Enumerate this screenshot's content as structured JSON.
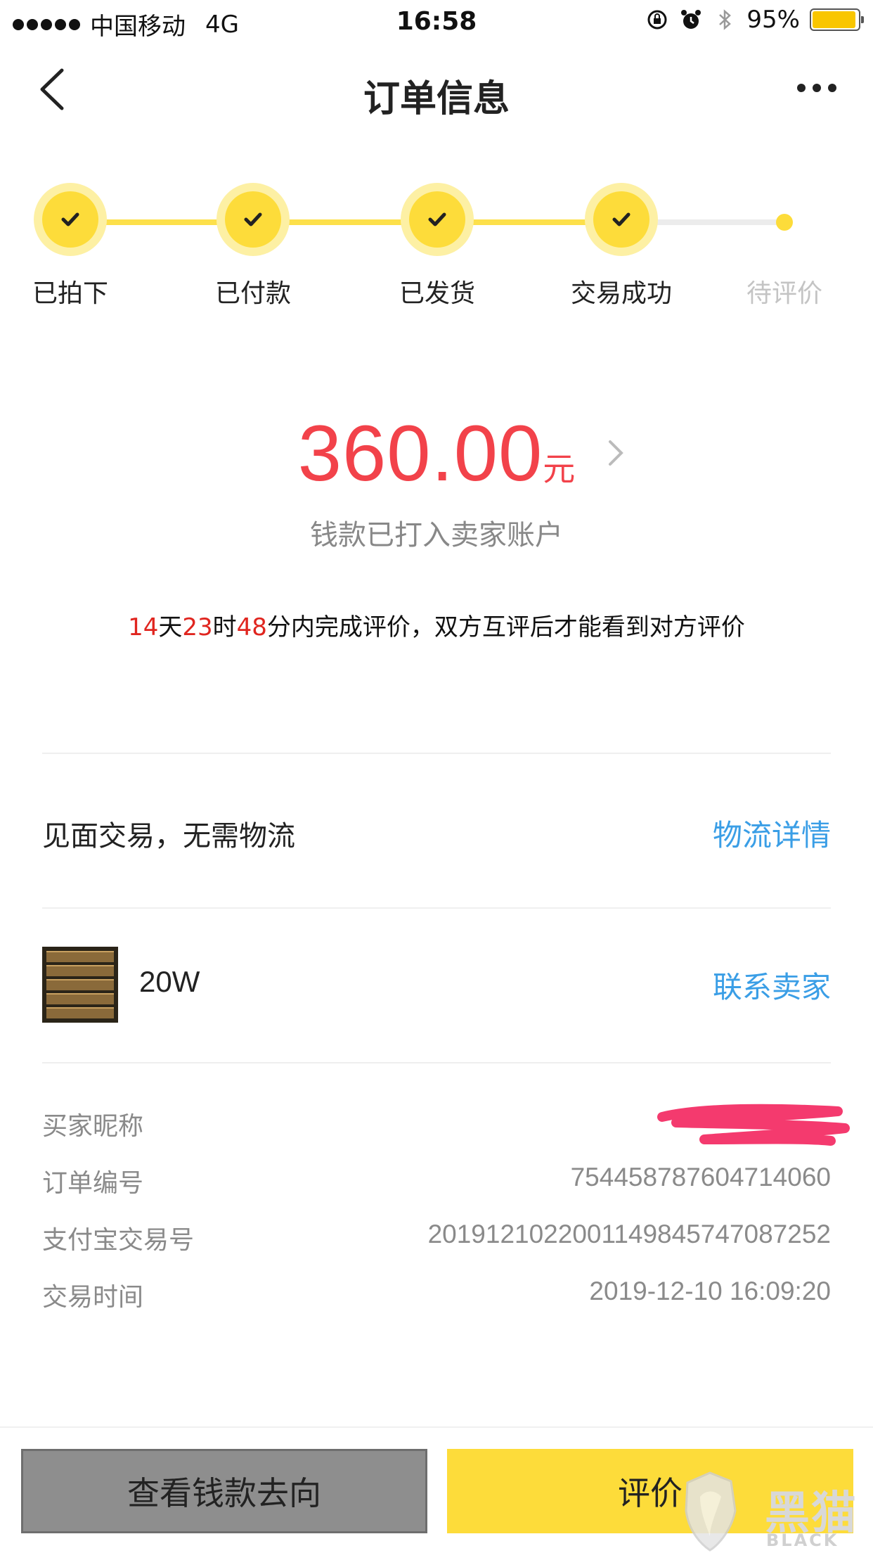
{
  "status_bar": {
    "carrier": "中国移动",
    "network": "4G",
    "time": "16:58",
    "battery_text": "95%",
    "battery_level": 0.95,
    "battery_color": "#f9c600"
  },
  "nav": {
    "title": "订单信息"
  },
  "steps": [
    {
      "label": "已拍下",
      "done": true
    },
    {
      "label": "已付款",
      "done": true
    },
    {
      "label": "已发货",
      "done": true
    },
    {
      "label": "交易成功",
      "done": true
    },
    {
      "label": "待评价",
      "done": false
    }
  ],
  "amount": {
    "value": "360.00",
    "unit": "元",
    "note": "钱款已打入卖家账户"
  },
  "review_deadline": {
    "days": "14",
    "days_unit": "天",
    "hours": "23",
    "hours_unit": "时",
    "minutes": "48",
    "rest": "分内完成评价，双方互评后才能看到对方评价"
  },
  "logistics": {
    "text": "见面交易，无需物流",
    "link": "物流详情"
  },
  "product": {
    "name": "20W",
    "contact": "联系卖家"
  },
  "info": [
    {
      "label": "买家昵称",
      "value": ""
    },
    {
      "label": "订单编号",
      "value": "754458787604714060"
    },
    {
      "label": "支付宝交易号",
      "value": "2019121022001149845747087252"
    },
    {
      "label": "交易时间",
      "value": "2019-12-10 16:09:20"
    }
  ],
  "actions": {
    "funds": "查看钱款去向",
    "review": "评价"
  },
  "watermark": {
    "text": "黑猫",
    "sub": "BLACK CAT"
  },
  "colors": {
    "accent_yellow": "#fddc3a",
    "price_red": "#f2424a",
    "link_blue": "#3a9ee6"
  }
}
